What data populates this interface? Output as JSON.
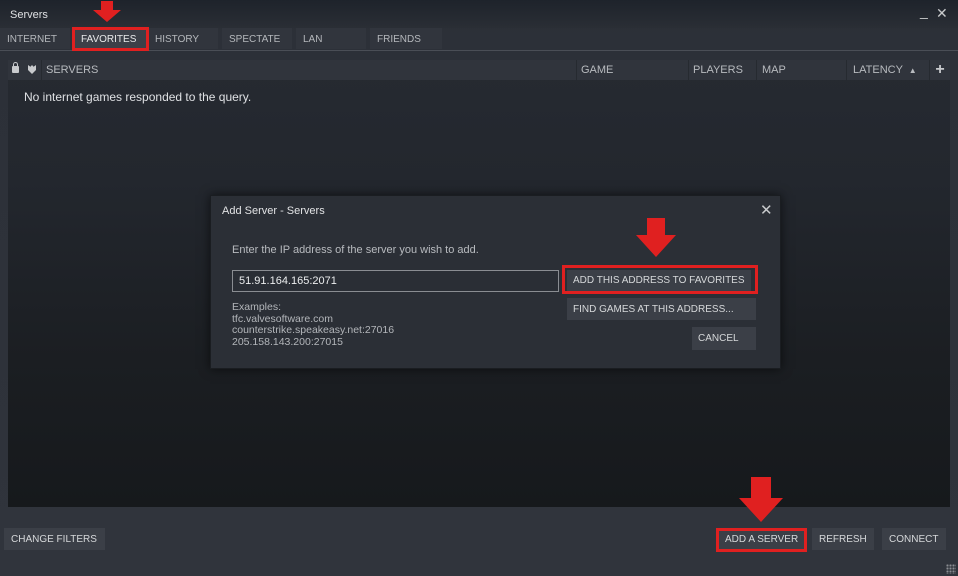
{
  "window": {
    "title": "Servers",
    "minimize_icon": "minimize-icon",
    "close_icon": "close-icon"
  },
  "tabs": [
    {
      "label": "INTERNET",
      "active": false
    },
    {
      "label": "FAVORITES",
      "active": true
    },
    {
      "label": "HISTORY",
      "active": false
    },
    {
      "label": "SPECTATE",
      "active": false
    },
    {
      "label": "LAN",
      "active": false
    },
    {
      "label": "FRIENDS",
      "active": false
    }
  ],
  "columns": {
    "lock_icon": "lock-icon",
    "secure_icon": "shield-icon",
    "servers": "SERVERS",
    "game": "GAME",
    "players": "PLAYERS",
    "map": "MAP",
    "latency": "LATENCY",
    "latency_sort": "▲",
    "add_column": "+"
  },
  "list": {
    "empty_message": "No internet games responded to the query."
  },
  "dialog": {
    "title": "Add Server - Servers",
    "close": "✕",
    "prompt": "Enter the IP address of the server you wish to add.",
    "address_value": "51.91.164.165:2071",
    "examples_label": "Examples:",
    "examples": [
      "tfc.valvesoftware.com",
      "counterstrike.speakeasy.net:27016",
      "205.158.143.200:27015"
    ],
    "add_favorites_label": "ADD THIS ADDRESS TO FAVORITES",
    "find_games_label": "FIND GAMES AT THIS ADDRESS...",
    "cancel_label": "CANCEL"
  },
  "footer": {
    "change_filters": "CHANGE FILTERS",
    "add_server": "ADD A SERVER",
    "refresh": "REFRESH",
    "connect": "CONNECT"
  },
  "annotations": {
    "highlight_color": "#e02020"
  }
}
